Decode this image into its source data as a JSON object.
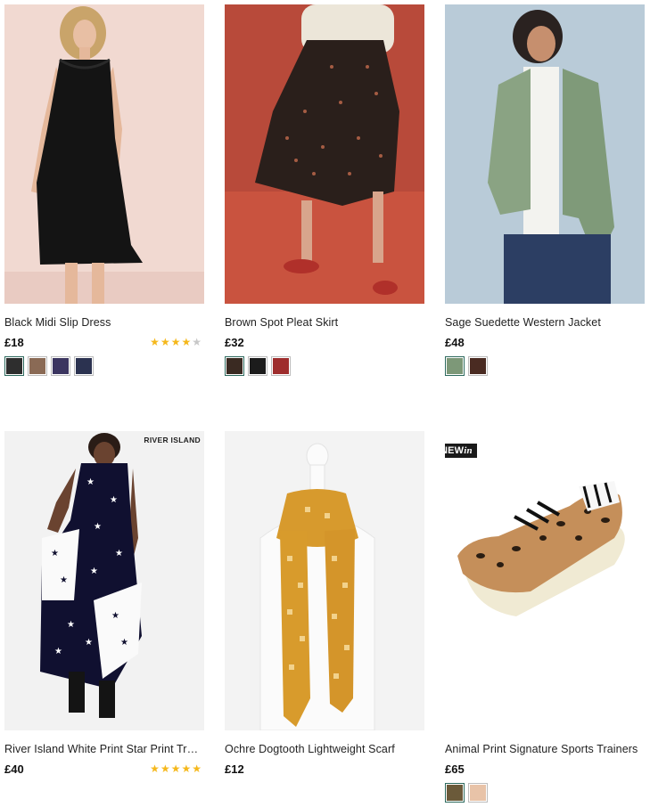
{
  "products": [
    {
      "title": "Black Midi Slip Dress",
      "price": "£18",
      "rating": 4,
      "rating_max": 5,
      "rating_text": "4 of 5 stars",
      "swatches": [
        "#2e2e2e",
        "#8a6a55",
        "#3b3560",
        "#2b3250"
      ]
    },
    {
      "title": "Brown Spot Pleat Skirt",
      "price": "£32",
      "swatches": [
        "#3a2a22",
        "#1c1c1c",
        "#9e2d2d"
      ]
    },
    {
      "title": "Sage Suedette Western Jacket",
      "price": "£48",
      "swatches": [
        "#7d9878",
        "#4a2b22"
      ]
    },
    {
      "title": "River Island White Print Star Print Trac...",
      "price": "£40",
      "rating": 5,
      "rating_max": 5,
      "rating_text": "5 of 5 stars",
      "brand_tag": "RIVER ISLAND"
    },
    {
      "title": "Ochre Dogtooth Lightweight Scarf",
      "price": "£12"
    },
    {
      "title": "Animal Print Signature Sports Trainers",
      "price": "£65",
      "badge_new": "NEW",
      "badge_in": "in",
      "swatches": [
        "#6b5a3a",
        "#e8c3a8"
      ]
    }
  ],
  "colors": {
    "star_on": "#f5b81c",
    "star_off": "#c8c8c8",
    "selected_swatch_border": "#2d6a5e"
  }
}
